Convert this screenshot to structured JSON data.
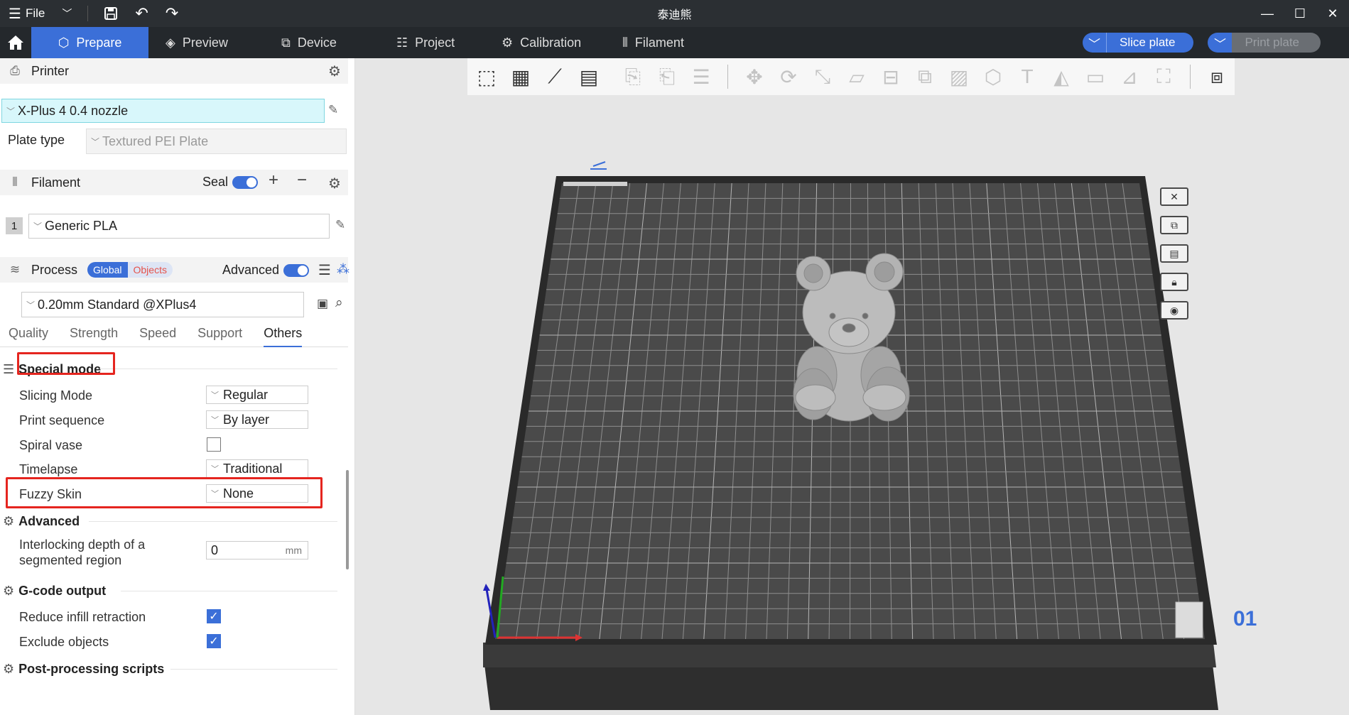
{
  "titlebar": {
    "file_label": "File",
    "window_title": "泰迪熊"
  },
  "nav": {
    "tabs": [
      {
        "label": "Prepare",
        "icon": "cube-icon"
      },
      {
        "label": "Preview",
        "icon": "layers-icon"
      },
      {
        "label": "Device",
        "icon": "device-icon"
      },
      {
        "label": "Project",
        "icon": "list-icon"
      },
      {
        "label": "Calibration",
        "icon": "gear-icon"
      },
      {
        "label": "Filament",
        "icon": "filament-icon"
      }
    ],
    "slice_label": "Slice plate",
    "print_label": "Print plate"
  },
  "printer": {
    "header": "Printer",
    "selected": "X-Plus 4 0.4 nozzle",
    "plate_type_label": "Plate type",
    "plate_type_value": "Textured PEI Plate"
  },
  "filament": {
    "header": "Filament",
    "seal_label": "Seal",
    "slot_number": "1",
    "value": "Generic PLA"
  },
  "process": {
    "header": "Process",
    "scope_global": "Global",
    "scope_objects": "Objects",
    "advanced_label": "Advanced",
    "preset": "0.20mm Standard @XPlus4",
    "tabs": [
      "Quality",
      "Strength",
      "Speed",
      "Support",
      "Others"
    ],
    "active_tab": "Others"
  },
  "settings": {
    "special_mode": {
      "title": "Special mode",
      "slicing_mode_label": "Slicing Mode",
      "slicing_mode_value": "Regular",
      "print_sequence_label": "Print sequence",
      "print_sequence_value": "By layer",
      "spiral_vase_label": "Spiral vase",
      "timelapse_label": "Timelapse",
      "timelapse_value": "Traditional",
      "fuzzy_skin_label": "Fuzzy Skin",
      "fuzzy_skin_value": "None"
    },
    "advanced": {
      "title": "Advanced",
      "interlocking_label_1": "Interlocking depth of a",
      "interlocking_label_2": "segmented region",
      "interlocking_value": "0",
      "interlocking_unit": "mm"
    },
    "gcode_output": {
      "title": "G-code output",
      "reduce_infill_label": "Reduce infill retraction",
      "exclude_objects_label": "Exclude objects"
    },
    "post_processing": {
      "title": "Post-processing scripts"
    }
  },
  "viewport": {
    "plate_number": "01",
    "highlight_color": "#e5251f",
    "accent_color": "#3b6fd8"
  }
}
